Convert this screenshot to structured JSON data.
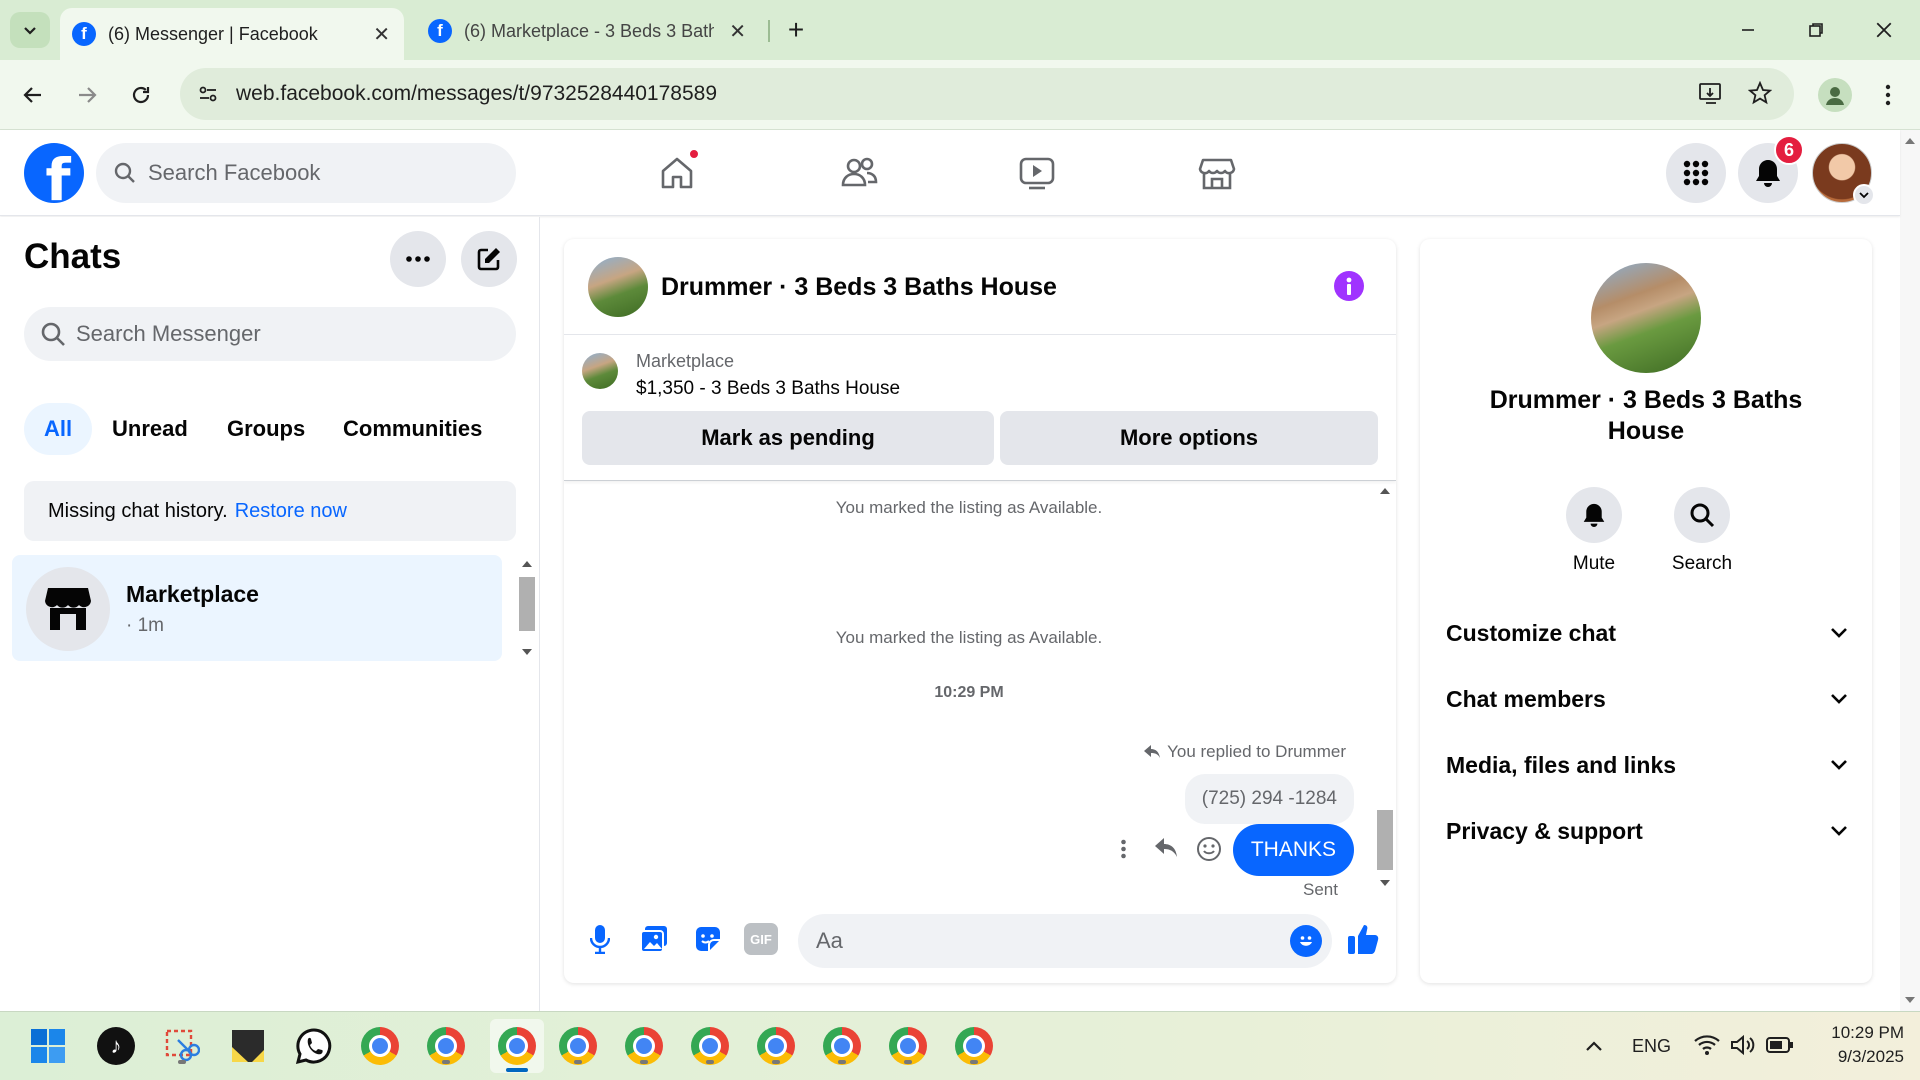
{
  "browser": {
    "tabs": [
      {
        "title": "(6) Messenger | Facebook",
        "active": true
      },
      {
        "title": "(6) Marketplace - 3 Beds 3 Bath",
        "active": false
      }
    ],
    "url": "web.facebook.com/messages/t/9732528440178589"
  },
  "fb_header": {
    "search_placeholder": "Search Facebook",
    "notification_count": "6"
  },
  "chats_panel": {
    "title": "Chats",
    "search_placeholder": "Search Messenger",
    "filters": [
      "All",
      "Unread",
      "Groups",
      "Communities"
    ],
    "active_filter": "All",
    "notice_text": "Missing chat history.",
    "notice_link": "Restore now",
    "chat_item": {
      "name": "Marketplace",
      "time": "· 1m"
    }
  },
  "conversation": {
    "title": "Drummer · 3 Beds 3 Baths House",
    "listing_label": "Marketplace",
    "listing_title": "$1,350 - 3 Beds 3 Baths House",
    "mark_pending_label": "Mark as pending",
    "more_options_label": "More options",
    "system_messages": [
      "You marked the listing as Available.",
      "You marked the listing as Available."
    ],
    "timestamp": "10:29 PM",
    "reply_note": "You replied to Drummer",
    "quoted_text": "(725) 294 -1284",
    "sent_message": "THANKS",
    "sent_status": "Sent",
    "composer_placeholder": "Aa"
  },
  "info_panel": {
    "name": "Drummer · 3 Beds 3 Baths House",
    "mute_label": "Mute",
    "search_label": "Search",
    "sections": [
      "Customize chat",
      "Chat members",
      "Media, files and links",
      "Privacy & support"
    ]
  },
  "taskbar": {
    "language": "ENG",
    "time": "10:29 PM",
    "date": "9/3/2025"
  },
  "colors": {
    "facebook_blue": "#0866ff",
    "info_purple": "#a033ff",
    "notification_red": "#e41e3f",
    "browser_green": "#d9ecd3"
  }
}
